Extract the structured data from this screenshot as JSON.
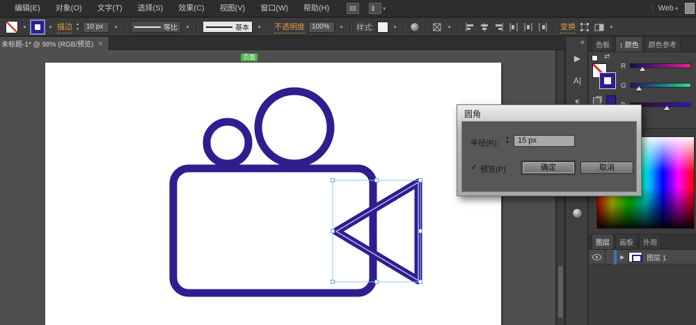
{
  "icons": {
    "dropdown": "▾",
    "up": "▲",
    "down": "▼",
    "collapse": "«",
    "close": "×",
    "check": "✓",
    "expand": "▶",
    "swap": "⇄",
    "updown": "↕",
    "paragraph": "¶",
    "character": "A|",
    "play": "▶",
    "pipe": "|"
  },
  "menubar": {
    "items": [
      "编辑(E)",
      "对象(O)",
      "文字(T)",
      "选择(S)",
      "效果(C)",
      "视图(V)",
      "窗口(W)",
      "帮助(H)"
    ],
    "workspace": "Web"
  },
  "controlbar": {
    "stroke_link": "描边",
    "stroke_width": "10 px",
    "profile": "等比",
    "brush": "基本",
    "opacity_link": "不透明度",
    "opacity_value": "100%",
    "style_label": "样式:",
    "transform_link": "变换"
  },
  "document_tab": {
    "title": "未标题-1* @ 98% (RGB/预览)"
  },
  "canvas": {
    "page_label": "页面"
  },
  "dialog": {
    "title": "圆角",
    "radius_label": "半径(R):",
    "radius_value": "15 px",
    "preview_label": "预览(P)",
    "ok_label": "确定",
    "cancel_label": "取消"
  },
  "color_panel": {
    "tabs": [
      "色板",
      "颜色",
      "颜色参考"
    ],
    "r_label": "R",
    "g_label": "G",
    "b_label": "B",
    "stroke_color": "#2e1e8e"
  },
  "layers_panel": {
    "tabs": [
      "图层",
      "画板",
      "外观"
    ],
    "layer_name": "图层 1"
  },
  "colors": {
    "icon_stroke": "#2e1e8e",
    "icon_highlight": "#beb6f2",
    "selection_blue": "#8ec1ff",
    "link_orange": "#e09a43",
    "page_green": "#4db34d"
  }
}
